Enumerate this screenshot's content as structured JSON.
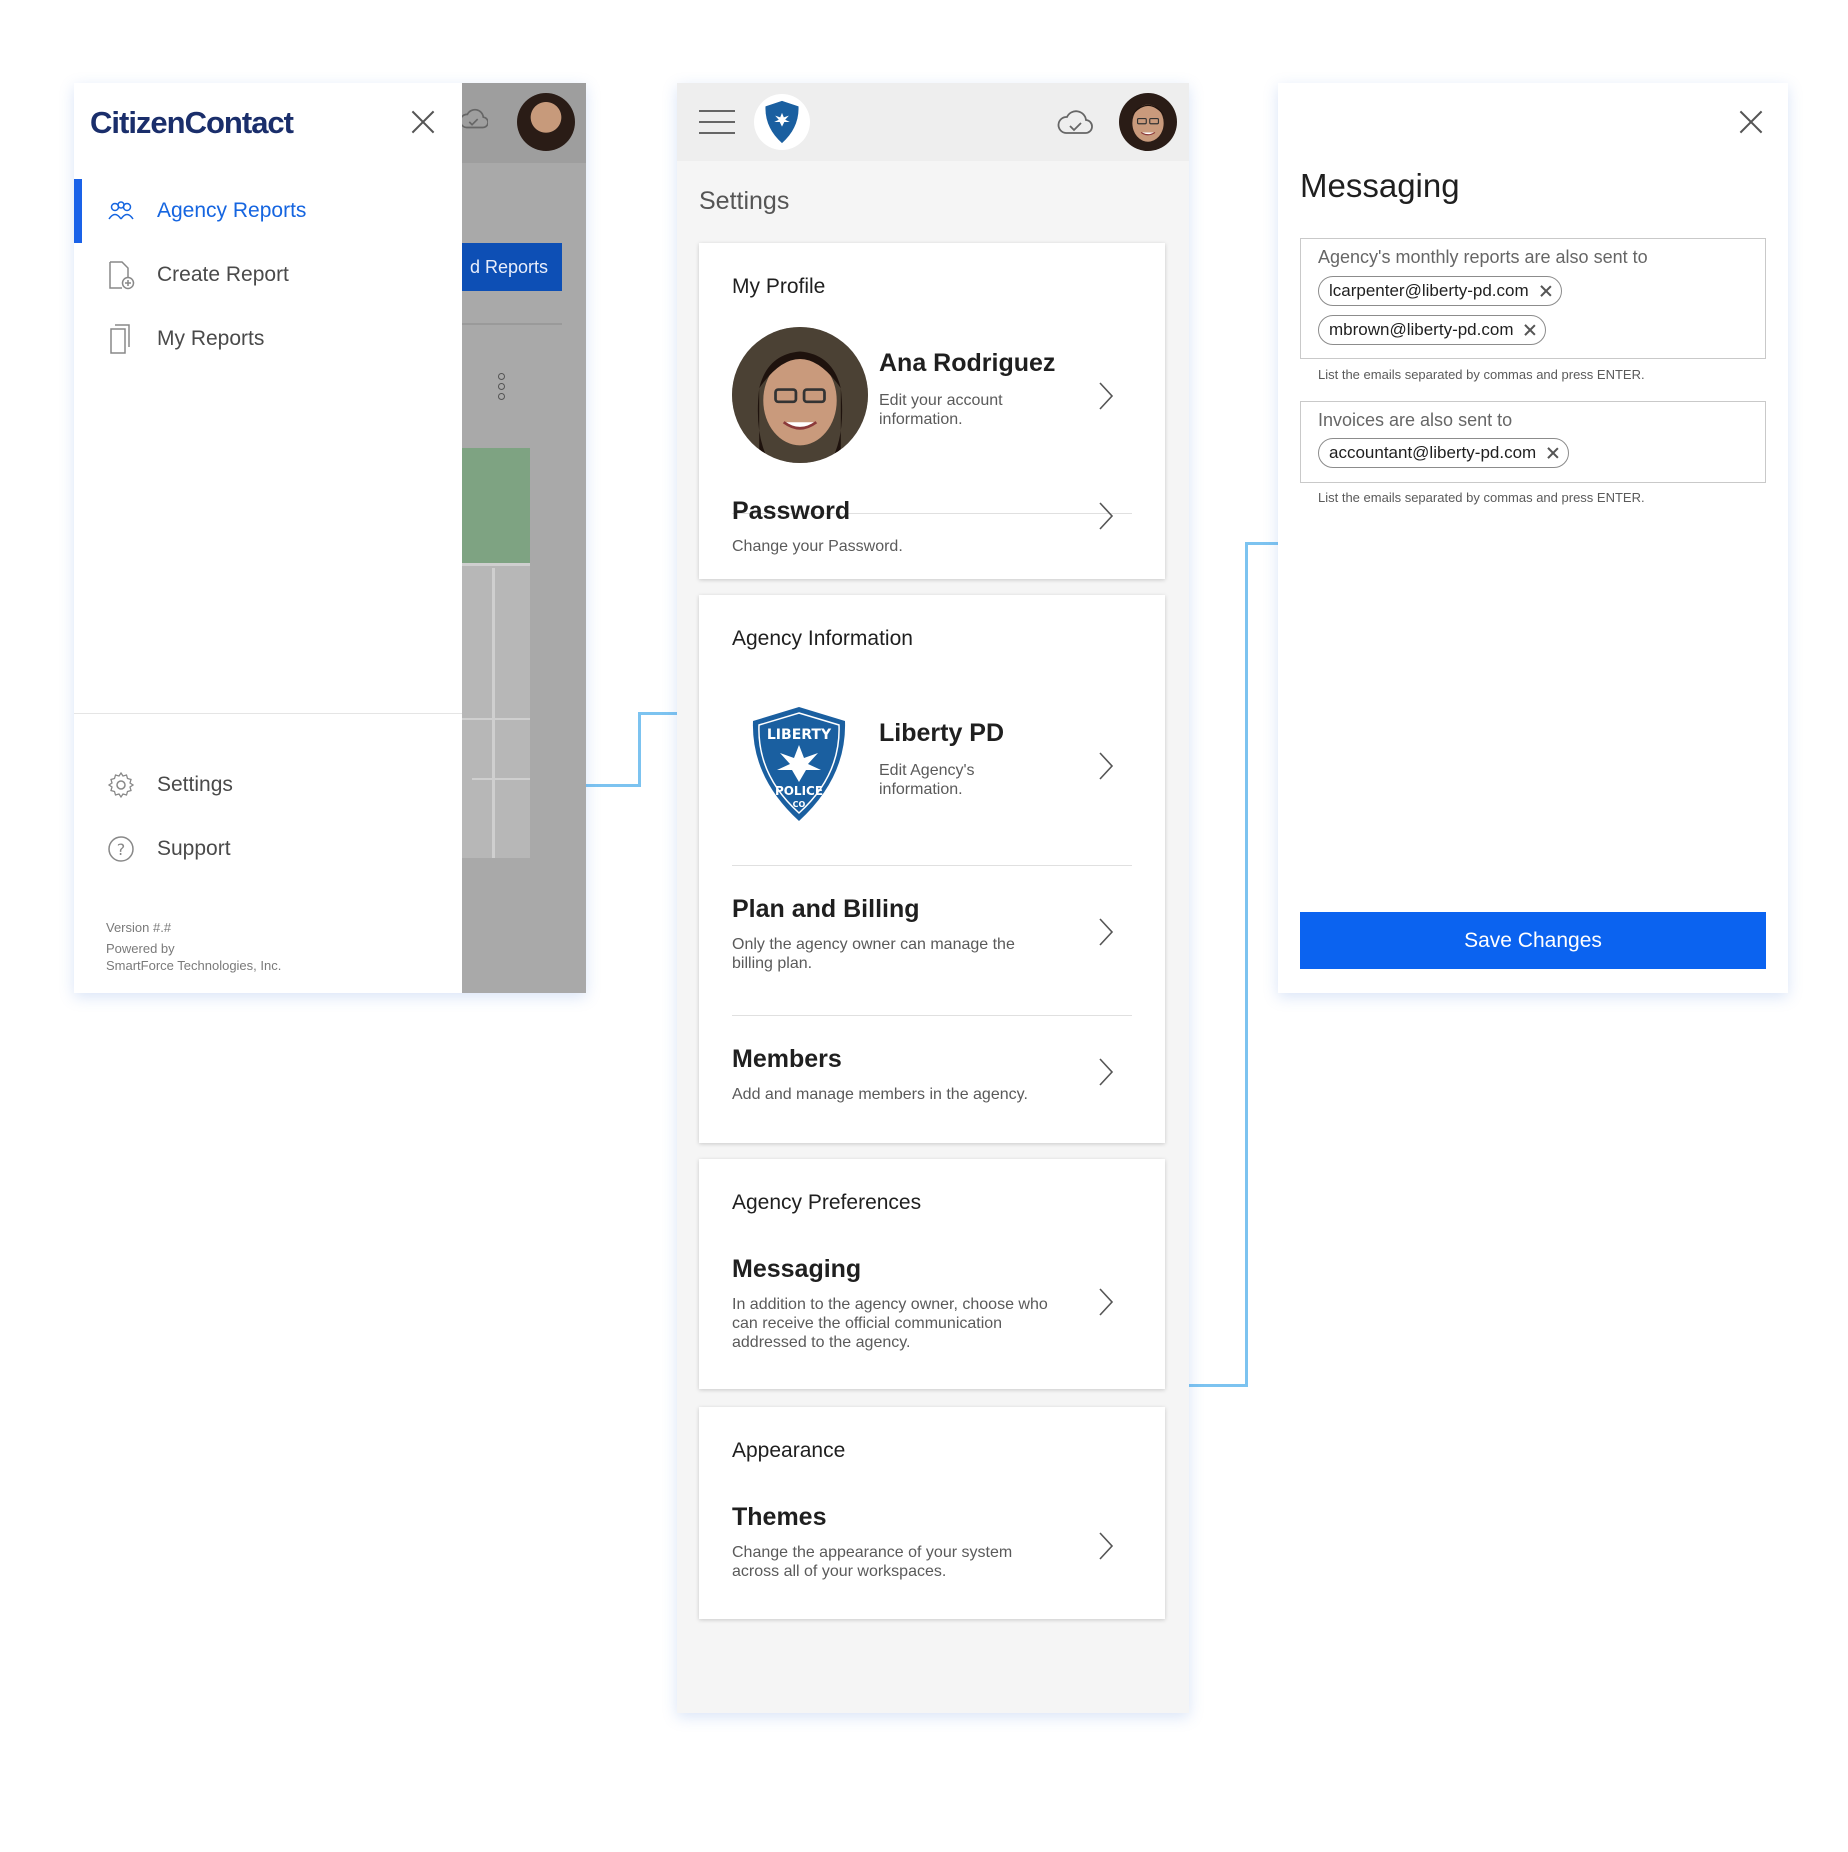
{
  "colors": {
    "accent": "#0b63f0",
    "brand_text": "#1a2e6b",
    "connector": "#7cc3f0"
  },
  "drawer": {
    "logo": "CitizenContact",
    "background_button_fragment": "d Reports",
    "items": [
      {
        "label": "Agency Reports",
        "icon": "people-icon",
        "active": true
      },
      {
        "label": "Create Report",
        "icon": "file-add-icon"
      },
      {
        "label": "My Reports",
        "icon": "documents-icon"
      }
    ],
    "bottom_items": [
      {
        "label": "Settings",
        "icon": "gear-icon"
      },
      {
        "label": "Support",
        "icon": "help-icon"
      }
    ],
    "version": "Version #.#",
    "powered_by": "Powered by",
    "company": "SmartForce Technologies, Inc."
  },
  "settings": {
    "title": "Settings",
    "my_profile": {
      "heading": "My Profile",
      "name": "Ana Rodriguez",
      "name_sub": "Edit your account information.",
      "password_title": "Password",
      "password_sub": "Change your Password."
    },
    "agency_information": {
      "heading": "Agency Information",
      "badge_top": "LIBERTY",
      "badge_bottom": "POLICE",
      "badge_co": "CO",
      "agency_name": "Liberty PD",
      "agency_sub": "Edit Agency's information.",
      "billing_title": "Plan and Billing",
      "billing_sub": "Only the agency owner can manage the billing plan.",
      "members_title": "Members",
      "members_sub": "Add and manage members in the agency."
    },
    "agency_preferences": {
      "heading": "Agency Preferences",
      "messaging_title": "Messaging",
      "messaging_sub": "In addition to the agency owner, choose who can receive the official communication addressed to the agency."
    },
    "appearance": {
      "heading": "Appearance",
      "themes_title": "Themes",
      "themes_sub": "Change the appearance of your system across all of your workspaces."
    }
  },
  "messaging": {
    "title": "Messaging",
    "reports_label": "Agency's monthly reports are also sent to",
    "reports_emails": [
      "lcarpenter@liberty-pd.com",
      "mbrown@liberty-pd.com"
    ],
    "invoices_label": "Invoices are also sent to",
    "invoices_emails": [
      "accountant@liberty-pd.com"
    ],
    "hint": "List the emails separated by commas and press ENTER.",
    "save_label": "Save Changes"
  }
}
